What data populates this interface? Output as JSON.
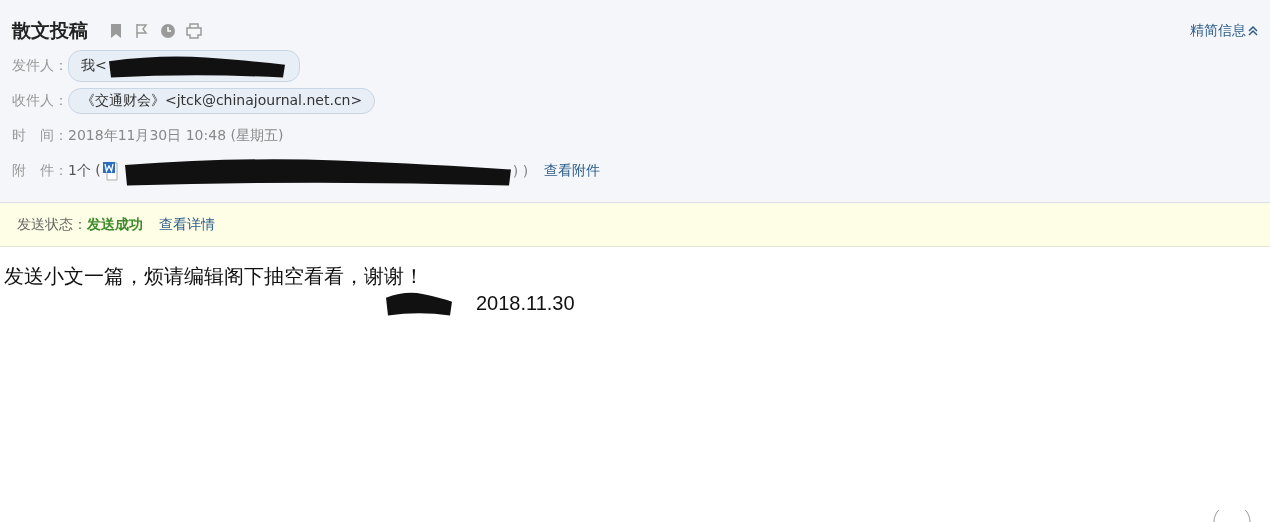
{
  "header": {
    "subject": "散文投稿",
    "toolbar": [
      {
        "kind": "bookmark"
      },
      {
        "kind": "flag"
      },
      {
        "kind": "clock"
      },
      {
        "kind": "print"
      }
    ],
    "toggle": "精简信息"
  },
  "fields": [
    {
      "kind": "address",
      "label": "发件人：",
      "value": "我<",
      "redacted": true
    },
    {
      "kind": "address",
      "label": "收件人：",
      "value": "《交通财会》<jtck@chinajournal.net.cn>",
      "redacted": false
    },
    {
      "kind": "text",
      "label": "时　间：",
      "value": "2018年11月30日 10:48 (星期五)"
    },
    {
      "kind": "attachment",
      "label": "附　件：",
      "value": "1个 (",
      "tail": ") )",
      "link": "查看附件"
    }
  ],
  "status": {
    "label": "发送状态：",
    "value": "发送成功",
    "link": "查看详情"
  },
  "body": {
    "lines": [
      "发送小文一篇，烦请编辑阁下抽空看看，谢谢！"
    ],
    "date": "2018.11.30"
  }
}
